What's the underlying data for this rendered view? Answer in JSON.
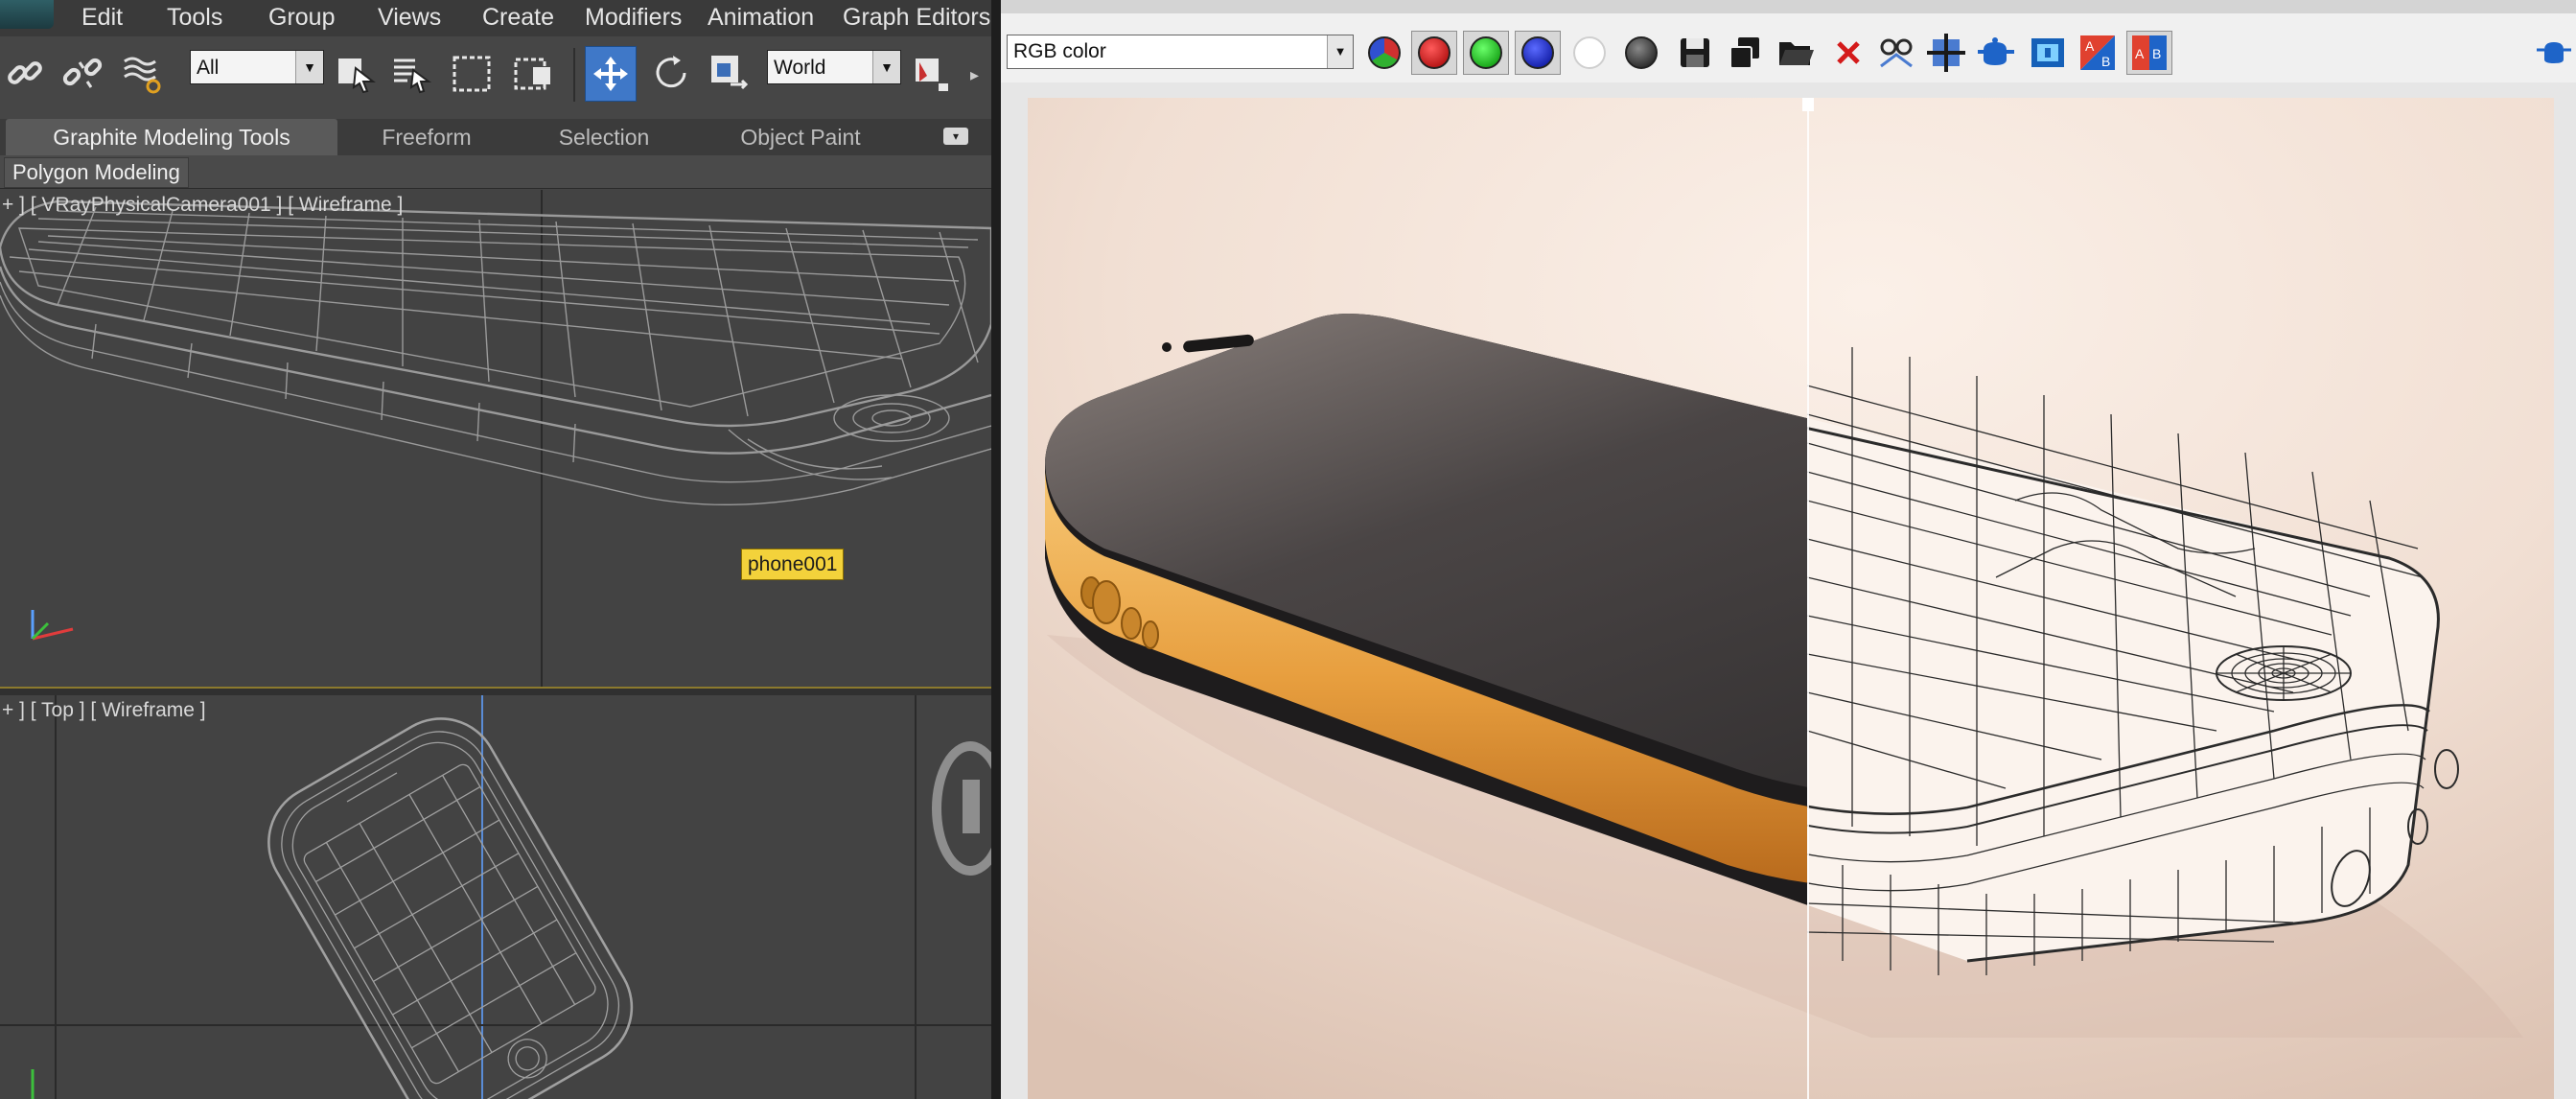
{
  "menu": {
    "items": [
      "Edit",
      "Tools",
      "Group",
      "Views",
      "Create",
      "Modifiers",
      "Animation",
      "Graph Editors"
    ]
  },
  "toolbar": {
    "selection_filter": "All",
    "reference_coord": "World",
    "icons": [
      "link-icon",
      "unlink-icon",
      "bind-space-warp-icon",
      "select-object-icon",
      "select-by-name-icon",
      "rectangular-selection-icon",
      "window-crossing-icon",
      "select-and-move-icon",
      "select-and-rotate-icon",
      "select-and-scale-icon",
      "named-selection-icon"
    ]
  },
  "ribbon": {
    "tabs": [
      "Graphite Modeling Tools",
      "Freeform",
      "Selection",
      "Object Paint"
    ],
    "active_tab": "Graphite Modeling Tools",
    "panel_label": "Polygon Modeling"
  },
  "viewports": {
    "camera": {
      "label": "+ ] [ VRayPhysicalCamera001 ] [ Wireframe ]"
    },
    "top": {
      "label": "+ ] [ Top ] [ Wireframe ]"
    },
    "object_label": "phone001"
  },
  "vfb": {
    "channel": "RGB color",
    "buttons": [
      "color-channels-icon",
      "red-channel-icon",
      "green-channel-icon",
      "blue-channel-icon",
      "alpha-channel-icon",
      "monochrome-icon",
      "save-image-icon",
      "clone-frame-buffer-icon",
      "load-image-icon",
      "clear-image-icon",
      "track-mouse-icon",
      "render-region-icon",
      "render-icon",
      "show-pixel-info-icon",
      "swap-ab-icon",
      "compare-ab-icon"
    ],
    "compare_ratio": 0.51
  },
  "colors": {
    "phone_gold": "#e8a54a",
    "phone_screen": "#3c3a3b",
    "wire_dark": "#9a9a9a",
    "background_warm": "#f3e4da",
    "selection_tag": "#f3d23b"
  }
}
